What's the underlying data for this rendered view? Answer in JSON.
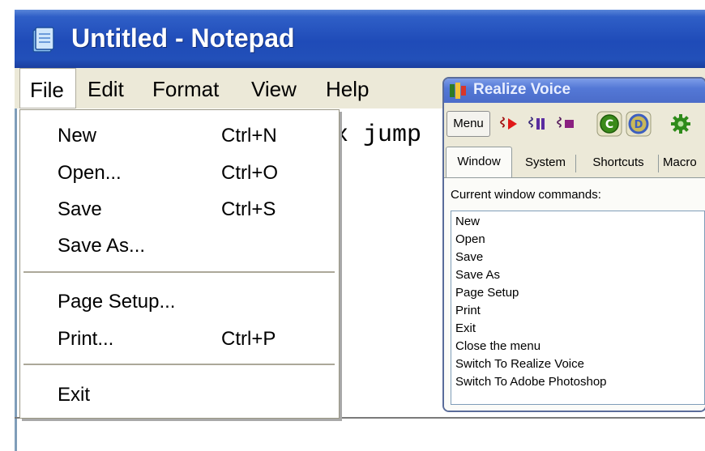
{
  "notepad": {
    "title": "Untitled - Notepad",
    "menus": [
      "File",
      "Edit",
      "Format",
      "View",
      "Help"
    ],
    "document_text": "x jump"
  },
  "file_menu": {
    "items": [
      {
        "label": "New",
        "shortcut": "Ctrl+N"
      },
      {
        "label": "Open...",
        "shortcut": "Ctrl+O"
      },
      {
        "label": "Save",
        "shortcut": "Ctrl+S"
      },
      {
        "label": "Save As...",
        "shortcut": ""
      },
      {
        "label": "Page Setup...",
        "shortcut": ""
      },
      {
        "label": "Print...",
        "shortcut": "Ctrl+P"
      },
      {
        "label": "Exit",
        "shortcut": ""
      }
    ]
  },
  "realize_voice": {
    "title": "Realize Voice",
    "menu_button": "Menu",
    "toolbar_icons": [
      "record-icon",
      "pause-icon",
      "stop-icon",
      "c-badge-icon",
      "d-badge-icon",
      "gear-icon"
    ],
    "tabs": [
      "Window",
      "System",
      "Shortcuts",
      "Macro"
    ],
    "active_tab": "Window",
    "panel_label": "Current window commands:",
    "commands": [
      "New",
      "Open",
      "Save",
      "Save As",
      "Page Setup",
      "Print",
      "Exit",
      "Close the menu",
      "Switch To Realize Voice",
      "Switch To Adobe Photoshop"
    ]
  },
  "colors": {
    "titlebar": "#2250b9",
    "menu_background": "#ece9d8",
    "record_red": "#e01818",
    "pause_purple": "#5a2ca0",
    "stop_purple": "#8a2080",
    "c_badge_green": "#3a8a1a",
    "d_badge_blue": "#3d5fbf",
    "gear_green": "#2e8b1a"
  }
}
